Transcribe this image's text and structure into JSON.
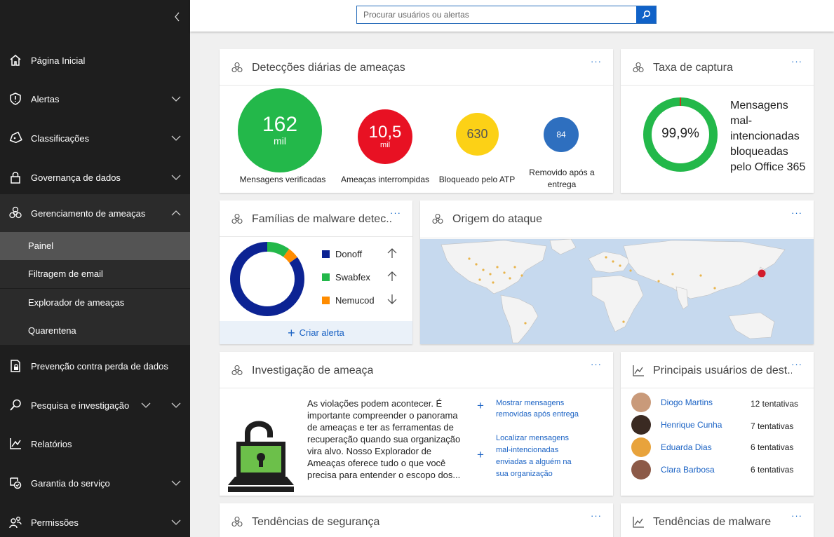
{
  "search": {
    "placeholder": "Procurar usuários ou alertas",
    "icon": "search-icon"
  },
  "sidebar": {
    "collapse_icon": "chevron-left-icon",
    "items": [
      {
        "label": "Página Inicial",
        "icon": "home-icon"
      },
      {
        "label": "Alertas",
        "icon": "shield-icon"
      },
      {
        "label": "Classificações",
        "icon": "tag-icon"
      },
      {
        "label": "Governança de dados",
        "icon": "lock-icon"
      },
      {
        "label": "Gerenciamento de ameaças",
        "icon": "biohazard-icon",
        "expanded": true
      },
      {
        "label": "Prevenção contra perda de dados",
        "icon": "document-lock-icon"
      },
      {
        "label": "Pesquisa e investigação",
        "icon": "search-icon"
      },
      {
        "label": "Relatórios",
        "icon": "chart-icon"
      },
      {
        "label": "Garantia do serviço",
        "icon": "service-icon"
      },
      {
        "label": "Permissões",
        "icon": "people-icon"
      }
    ],
    "subitems": [
      {
        "label": "Painel",
        "active": true
      },
      {
        "label": "Filtragem de email"
      },
      {
        "label": "Explorador de ameaças"
      },
      {
        "label": "Quarentena"
      }
    ]
  },
  "detections": {
    "title": "Detecções diárias de ameaças",
    "more": "···",
    "stats": [
      {
        "value": "162",
        "unit": "mil",
        "label": "Mensagens verificadas",
        "color": "#23b84a"
      },
      {
        "value": "10,5",
        "unit": "mil",
        "label": "Ameaças interrompidas",
        "color": "#e81123"
      },
      {
        "value": "630",
        "unit": "",
        "label": "Bloqueado pelo ATP",
        "color": "#fcd116"
      },
      {
        "value": "84",
        "unit": "",
        "label": "Removido após a entrega",
        "color": "#2e6fbf"
      }
    ]
  },
  "capture": {
    "title": "Taxa de captura",
    "more": "···",
    "percent": "99,9%",
    "fraction": 0.999,
    "description": [
      "Mensagens",
      "mal-",
      "intencionadas",
      "bloqueadas",
      "pelo Office 365"
    ],
    "color": "#23b84a"
  },
  "malware": {
    "title": "Famílias de malware detec...",
    "more": "···",
    "families": [
      {
        "name": "Donoff",
        "color": "#0c2393",
        "share": 0.85,
        "trend": "up"
      },
      {
        "name": "Swabfex",
        "color": "#23b84a",
        "share": 0.1,
        "trend": "up"
      },
      {
        "name": "Nemucod",
        "color": "#ff8c00",
        "share": 0.05,
        "trend": "down"
      }
    ],
    "create_alert": "Criar alerta"
  },
  "origin": {
    "title": "Origem do ataque",
    "more": "···"
  },
  "investigation": {
    "title": "Investigação de ameaça",
    "more": "···",
    "text": [
      "As violações podem acontecer. É",
      "importante compreender o panorama",
      "de ameaças e ter as ferramentas de",
      "recuperação quando sua organização",
      "vira alvo. Nosso Explorador de",
      "Ameaças oferece tudo o que você",
      "precisa para entender o escopo dos..."
    ],
    "links": [
      {
        "lines": [
          "Mostrar mensagens",
          "removidas após entrega"
        ]
      },
      {
        "lines": [
          "Localizar mensagens",
          "mal-intencionadas",
          "enviadas a alguém na",
          "sua organização"
        ]
      }
    ]
  },
  "top_users": {
    "title": "Principais usuários de dest...",
    "more": "···",
    "users": [
      {
        "name": "Diogo Martins",
        "attempts": "12 tentativas",
        "color": "#c99a7a"
      },
      {
        "name": "Henrique Cunha",
        "attempts": "7 tentativas",
        "color": "#3a2a22"
      },
      {
        "name": "Eduarda Dias",
        "attempts": "6 tentativas",
        "color": "#e8a33c"
      },
      {
        "name": "Clara Barbosa",
        "attempts": "6 tentativas",
        "color": "#8c5a48"
      }
    ]
  },
  "security_trends": {
    "title": "Tendências de segurança",
    "more": "···"
  },
  "malware_trends": {
    "title": "Tendências de malware",
    "more": "···"
  }
}
